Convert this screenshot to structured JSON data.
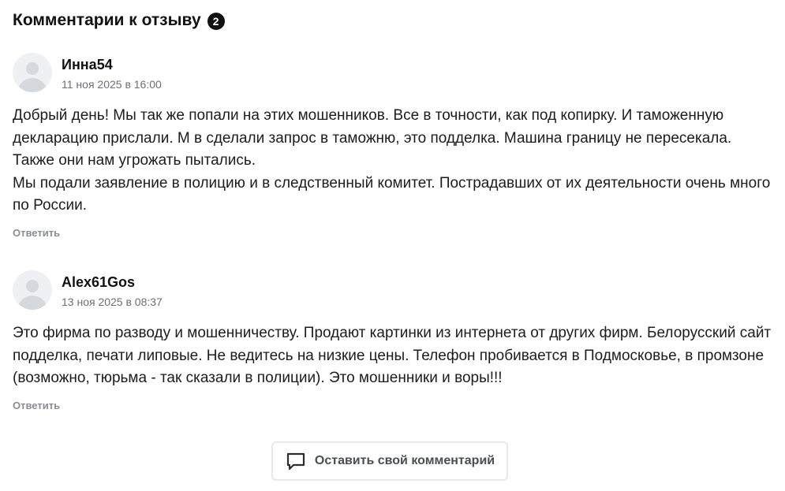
{
  "header": {
    "title": "Комментарии к отзыву",
    "count": "2"
  },
  "comments": [
    {
      "author": "Инна54",
      "date": "11 ноя 2025 в 16:00",
      "lines": [
        "Добрый день! Мы так же попали на этих мошенников. Все в точности, как под копирку. И таможенную декларацию прислали. М в сделали запрос в таможню, это подделка. Машина границу не пересекала. Также они нам угрожать пытались.",
        "Мы подали заявление в полицию и в следственный комитет. Пострадавших от их деятельности очень много по России."
      ],
      "reply_label": "Ответить"
    },
    {
      "author": "Alex61Gos",
      "date": "13 ноя 2025 в 08:37",
      "lines": [
        "Это фирма по разводу и мошенничеству. Продают картинки из интернета от других фирм. Белорусский сайт подделка, печати липовые. Не ведитесь на низкие цены. Телефон пробивается в Подмосковье, в промзоне (возможно, тюрьма - так сказали в полиции). Это мошенники и воры!!!"
      ],
      "reply_label": "Ответить"
    }
  ],
  "leave_comment": {
    "label": "Оставить свой комментарий",
    "icon": "comment-bubble-icon"
  }
}
